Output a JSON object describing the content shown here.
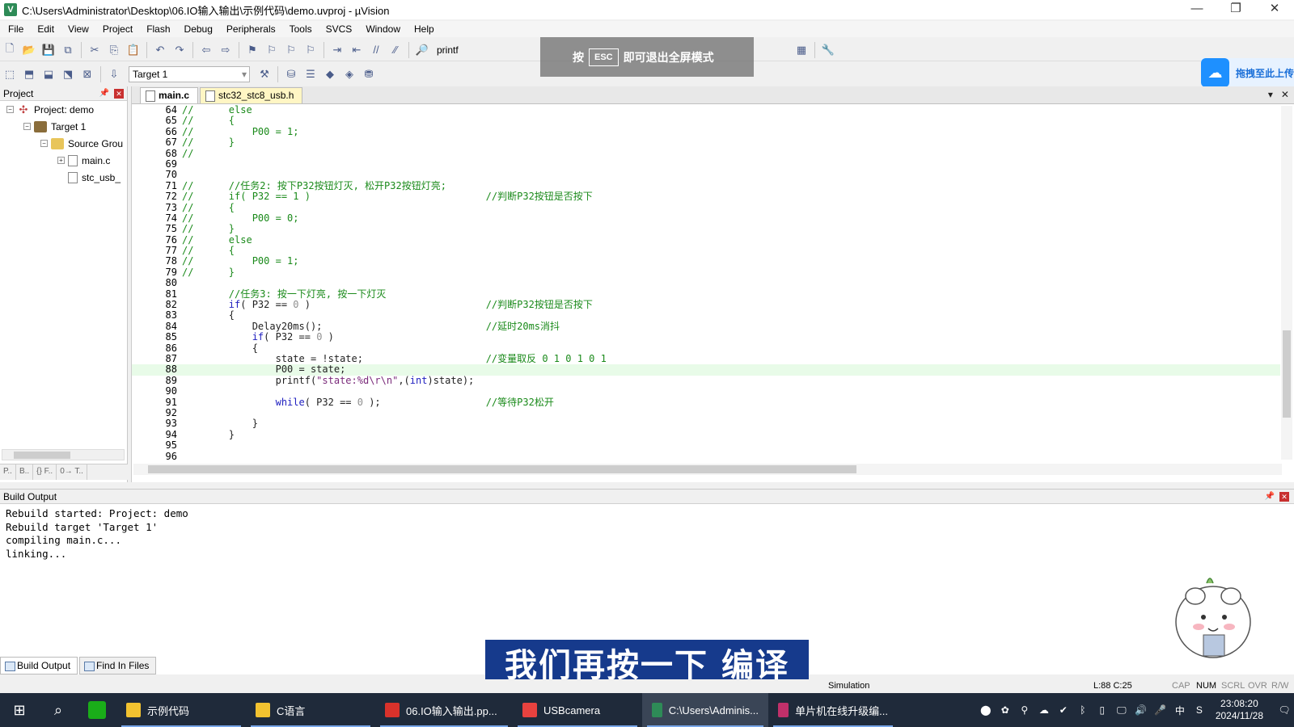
{
  "window": {
    "title": "C:\\Users\\Administrator\\Desktop\\06.IO输入输出\\示例代码\\demo.uvproj - µVision",
    "minimize": "—",
    "maximize": "❐",
    "close": "✕"
  },
  "menu": [
    "File",
    "Edit",
    "View",
    "Project",
    "Flash",
    "Debug",
    "Peripherals",
    "Tools",
    "SVCS",
    "Window",
    "Help"
  ],
  "toolbar": {
    "find_value": "printf",
    "target_value": "Target 1"
  },
  "fullscreen_hint": {
    "prefix": "按",
    "key": "ESC",
    "suffix": "即可退出全屏模式"
  },
  "cloud_button": {
    "label": "拖拽至此上传",
    "icon": "cloud-upload-icon"
  },
  "project_panel": {
    "title": "Project",
    "tree": [
      {
        "label": "Project: demo",
        "icon": "project-icon",
        "expander": "−",
        "level": 0
      },
      {
        "label": "Target 1",
        "icon": "target-icon",
        "expander": "−",
        "level": 1
      },
      {
        "label": "Source Grou",
        "icon": "folder-icon",
        "expander": "−",
        "level": 2
      },
      {
        "label": "main.c",
        "icon": "file-icon",
        "expander": "+",
        "level": 3
      },
      {
        "label": "stc_usb_",
        "icon": "file-icon",
        "expander": "",
        "level": 3
      }
    ],
    "tabs": [
      "P..",
      "B..",
      "{} F..",
      "0→ T.."
    ]
  },
  "editor": {
    "tabs": [
      {
        "label": "main.c",
        "active": true
      },
      {
        "label": "stc32_stc8_usb.h",
        "active": false
      }
    ],
    "current_line": 88,
    "cursor_position": "L:88 C:25"
  },
  "code_lines": [
    {
      "n": "64",
      "t": "//      else"
    },
    {
      "n": "65",
      "t": "//      {"
    },
    {
      "n": "66",
      "t": "//          P00 = 1;"
    },
    {
      "n": "67",
      "t": "//      }"
    },
    {
      "n": "68",
      "t": "//"
    },
    {
      "n": "69",
      "t": ""
    },
    {
      "n": "70",
      "t": ""
    },
    {
      "n": "71",
      "t": "//      //任务2: 按下P32按钮灯灭, 松开P32按钮灯亮;"
    },
    {
      "n": "72",
      "t": "//      if( P32 == 1 )                              //判断P32按钮是否按下"
    },
    {
      "n": "73",
      "t": "//      {"
    },
    {
      "n": "74",
      "t": "//          P00 = 0;"
    },
    {
      "n": "75",
      "t": "//      }"
    },
    {
      "n": "76",
      "t": "//      else"
    },
    {
      "n": "77",
      "t": "//      {"
    },
    {
      "n": "78",
      "t": "//          P00 = 1;"
    },
    {
      "n": "79",
      "t": "//      }"
    },
    {
      "n": "80",
      "t": ""
    },
    {
      "n": "81",
      "t": "        //任务3: 按一下灯亮, 按一下灯灭"
    },
    {
      "n": "82",
      "t": "        if( P32 == 0 )                              //判断P32按钮是否按下"
    },
    {
      "n": "83",
      "t": "        {"
    },
    {
      "n": "84",
      "t": "            Delay20ms();                            //延时20ms消抖"
    },
    {
      "n": "85",
      "t": "            if( P32 == 0 )"
    },
    {
      "n": "86",
      "t": "            {"
    },
    {
      "n": "87",
      "t": "                state = !state;                     //变量取反 0 1 0 1 0 1"
    },
    {
      "n": "88",
      "t": "                P00 = state;"
    },
    {
      "n": "89",
      "t": "                printf(\"state:%d\\r\\n\",(int)state);"
    },
    {
      "n": "90",
      "t": ""
    },
    {
      "n": "91",
      "t": "                while( P32 == 0 );                  //等待P32松开"
    },
    {
      "n": "92",
      "t": ""
    },
    {
      "n": "93",
      "t": "            }"
    },
    {
      "n": "94",
      "t": "        }"
    },
    {
      "n": "95",
      "t": ""
    },
    {
      "n": "96",
      "t": ""
    }
  ],
  "build_output": {
    "title": "Build Output",
    "text": "Rebuild started: Project: demo\nRebuild target 'Target 1'\ncompiling main.c...\nlinking...",
    "tabs": [
      "Build Output",
      "Find In Files"
    ]
  },
  "status": {
    "mode": "Simulation",
    "cursor": "L:88 C:25",
    "caps": "CAP",
    "num": "NUM",
    "scrl": "SCRL",
    "ovr": "OVR",
    "rw": "R/W"
  },
  "subtitle": "我们再按一下 编译",
  "taskbar": {
    "apps": [
      {
        "label": "示例代码",
        "color": "#f2c230"
      },
      {
        "label": "C语言",
        "color": "#f2c230"
      },
      {
        "label": "06.IO输入输出.pp...",
        "color": "#d9322b"
      },
      {
        "label": "USBcamera",
        "color": "#e8423f"
      },
      {
        "label": "C:\\Users\\Adminis...",
        "color": "#2e8b57"
      },
      {
        "label": "单片机在线升级编...",
        "color": "#c0306a"
      }
    ],
    "tray_ime": "中",
    "time": "23:08:20",
    "date": "2024/11/28"
  }
}
